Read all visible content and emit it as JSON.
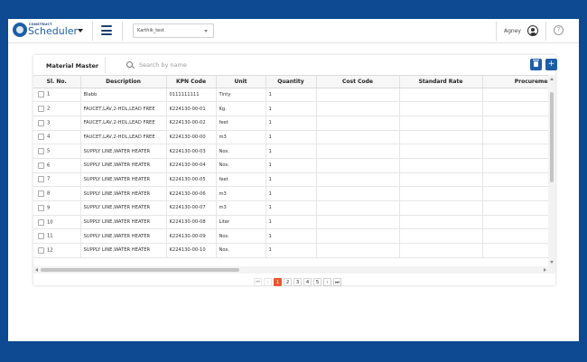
{
  "app": {
    "brand_small": "CONSTRUCT",
    "brand_main": "Scheduler",
    "project": "Karthik_test",
    "user": "Agney",
    "help_glyph": "?"
  },
  "panel": {
    "title": "Material Master",
    "search_placeholder": "Search by name",
    "add_label": "+"
  },
  "table": {
    "columns": [
      "Sl. No.",
      "Description",
      "KPN Code",
      "Unit",
      "Quantity",
      "Cost Code",
      "Standard Rate",
      "Procurement Type"
    ],
    "rows": [
      [
        "1",
        "Blabb",
        "0111111111",
        "Tinty",
        "1",
        "",
        "",
        ""
      ],
      [
        "2",
        "FAUCET,LAV,2-HDL,LEAD FREE",
        "K224130-00-01",
        "Kg.",
        "1",
        "",
        "",
        ""
      ],
      [
        "3",
        "FAUCET,LAV,2-HDL,LEAD FREE",
        "K224130-00-02",
        "feet",
        "1",
        "",
        "",
        ""
      ],
      [
        "4",
        "FAUCET,LAV,2-HDL,LEAD FREE",
        "K224130-00-00",
        "m3",
        "1",
        "",
        "",
        ""
      ],
      [
        "5",
        "SUPPLY LINE,WATER HEATER",
        "K224130-00-03",
        "Nos.",
        "1",
        "",
        "",
        ""
      ],
      [
        "6",
        "SUPPLY LINE,WATER HEATER",
        "K224130-00-04",
        "Nos.",
        "1",
        "",
        "",
        ""
      ],
      [
        "7",
        "SUPPLY LINE,WATER HEATER",
        "K224130-00-05",
        "feet",
        "1",
        "",
        "",
        ""
      ],
      [
        "8",
        "SUPPLY LINE,WATER HEATER",
        "K224130-00-06",
        "m3",
        "1",
        "",
        "",
        ""
      ],
      [
        "9",
        "SUPPLY LINE,WATER HEATER",
        "K224130-00-07",
        "m3",
        "1",
        "",
        "",
        ""
      ],
      [
        "10",
        "SUPPLY LINE,WATER HEATER",
        "K224130-00-08",
        "Liter",
        "1",
        "",
        "",
        ""
      ],
      [
        "11",
        "SUPPLY LINE,WATER HEATER",
        "K224130-00-09",
        "Nos.",
        "1",
        "",
        "",
        ""
      ],
      [
        "12",
        "SUPPLY LINE,WATER HEATER",
        "K224130-00-10",
        "Nos.",
        "1",
        "",
        "",
        ""
      ]
    ]
  },
  "pagination": {
    "first": "⏮",
    "prev": "‹",
    "pages": [
      "1",
      "2",
      "3",
      "4",
      "5"
    ],
    "active": "1",
    "next": "›",
    "last": "⏭"
  },
  "colors": {
    "frame_bg": "#0d4a91",
    "primary": "#1d5ea8",
    "active_page": "#e8572f"
  },
  "icons": [
    "logo-icon",
    "chevron-down-icon",
    "menu-icon",
    "user-icon",
    "help-icon",
    "search-icon",
    "trash-icon",
    "plus-icon"
  ]
}
